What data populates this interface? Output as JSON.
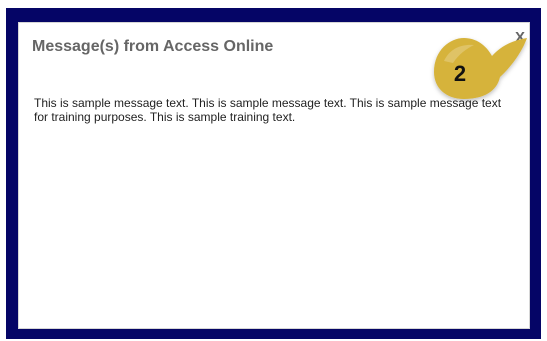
{
  "dialog": {
    "title": "Message(s) from Access Online",
    "close_label": "X",
    "message": "This is sample message text. This is sample message text. This is sample message text for training purposes. This is sample training text."
  },
  "callout": {
    "number": "2",
    "color": "#d6b33a",
    "icon_name": "callout-number-2"
  },
  "colors": {
    "frame": "#050566",
    "title": "#666666",
    "text": "#222222"
  }
}
